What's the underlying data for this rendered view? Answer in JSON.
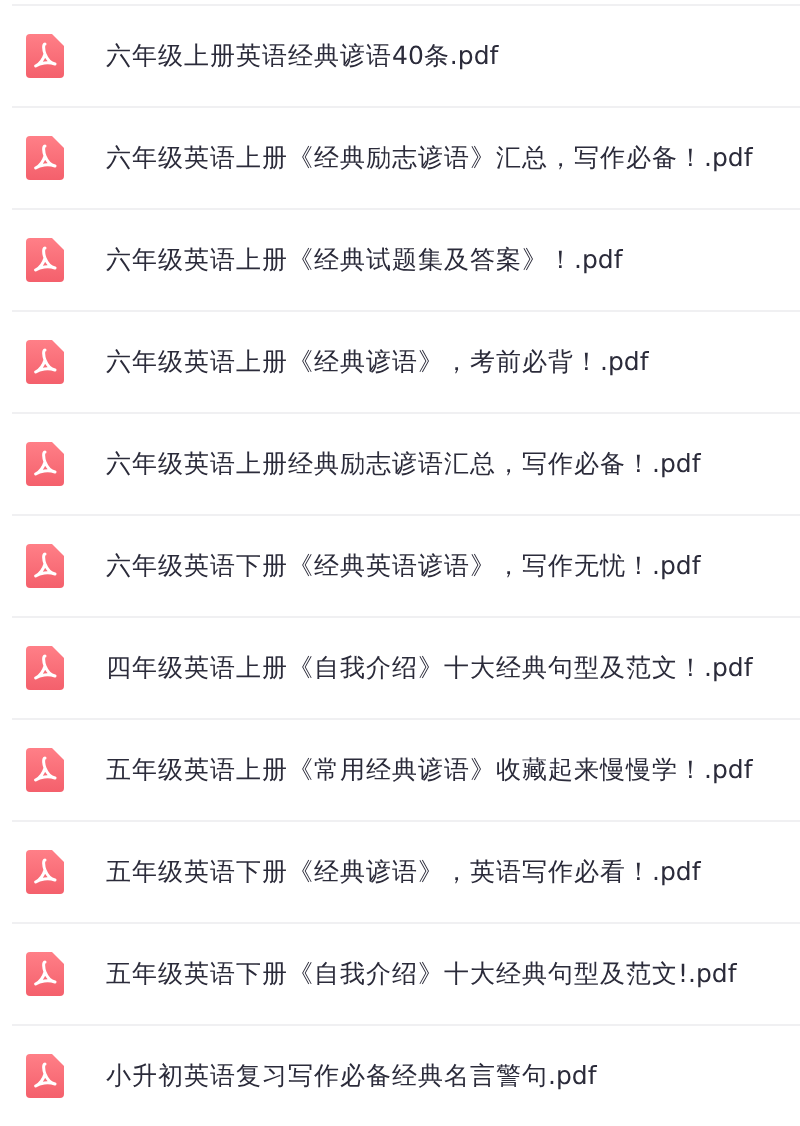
{
  "files": [
    {
      "name": "六年级上册英语经典谚语40条.pdf"
    },
    {
      "name": "六年级英语上册《经典励志谚语》汇总，写作必备！.pdf"
    },
    {
      "name": "六年级英语上册《经典试题集及答案》！.pdf"
    },
    {
      "name": "六年级英语上册《经典谚语》，考前必背！.pdf"
    },
    {
      "name": "六年级英语上册经典励志谚语汇总，写作必备！.pdf"
    },
    {
      "name": "六年级英语下册《经典英语谚语》，写作无忧！.pdf"
    },
    {
      "name": "四年级英语上册《自我介绍》十大经典句型及范文！.pdf"
    },
    {
      "name": "五年级英语上册《常用经典谚语》收藏起来慢慢学！.pdf"
    },
    {
      "name": "五年级英语下册《经典谚语》，英语写作必看！.pdf"
    },
    {
      "name": "五年级英语下册《自我介绍》十大经典句型及范文!.pdf"
    },
    {
      "name": "小升初英语复习写作必备经典名言警句.pdf"
    }
  ]
}
